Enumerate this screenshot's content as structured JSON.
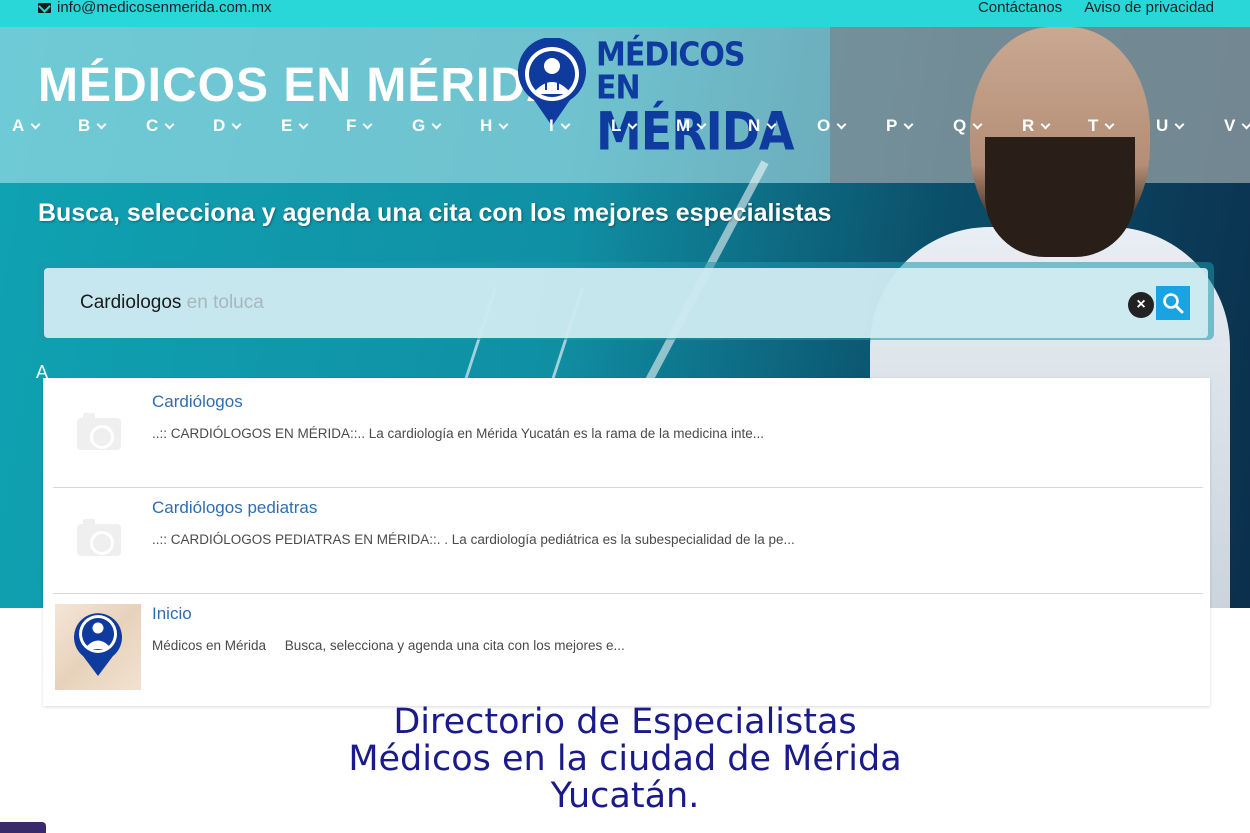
{
  "topbar": {
    "email": "info@medicosenmerida.com.mx",
    "links": [
      "Contáctanos",
      "Aviso de privacidad"
    ]
  },
  "site": {
    "title": "MÉDICOS EN MÉRIDA",
    "logo_line1": "MÉDICOS EN",
    "logo_line2": "MÉRIDA"
  },
  "alphabet": [
    "A",
    "B",
    "C",
    "D",
    "E",
    "F",
    "G",
    "H",
    "I",
    "L",
    "M",
    "N",
    "O",
    "P",
    "Q",
    "R",
    "T",
    "U",
    "V"
  ],
  "hero": {
    "tagline": "Busca, selecciona y agenda una cita con los mejores especialistas",
    "stray_letter": "A"
  },
  "search": {
    "query": "Cardiologos",
    "hint": " en toluca",
    "clear_label": "×"
  },
  "results": [
    {
      "title": "Cardiólogos",
      "description": "..:: CARDIÓLOGOS EN MÉRIDA::.. La cardiología en Mérida Yucatán es la rama de la medicina inte..."
    },
    {
      "title": "Cardiólogos pediatras",
      "description": "..:: CARDIÓLOGOS PEDIATRAS EN MÉRIDA::. . La cardiología pediátrica es la subespecialidad de la pe..."
    },
    {
      "title": "Inicio",
      "description": "Médicos en Mérida     Busca, selecciona y agenda una cita con los mejores e..."
    }
  ],
  "directory": {
    "line1": "Directorio de Especialistas",
    "line2": "Médicos en la ciudad de Mérida",
    "line3": "Yucatán."
  },
  "colors": {
    "topbar": "#29d6d8",
    "brand_blue": "#0f3a9e",
    "link_blue": "#2f6db3",
    "heading_navy": "#1a1a8a",
    "search_button": "#1aa3e3"
  },
  "icons": [
    "envelope-icon",
    "chevron-down-icon",
    "close-icon",
    "search-icon",
    "camera-placeholder-icon",
    "doctor-pin-icon"
  ]
}
